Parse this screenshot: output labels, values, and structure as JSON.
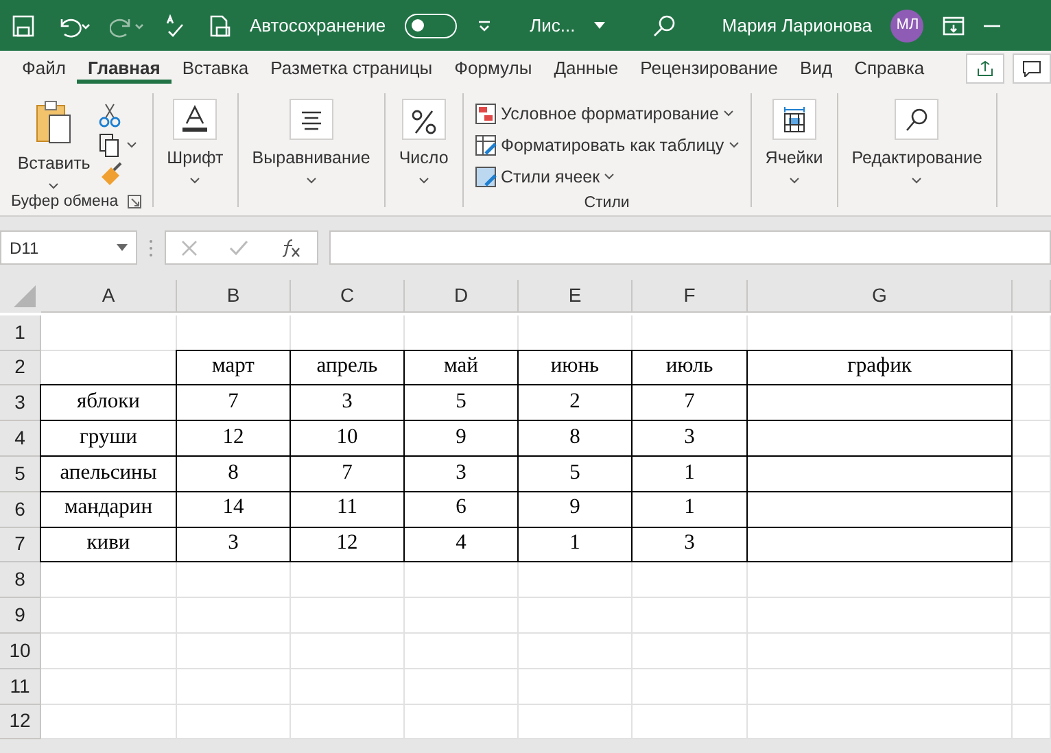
{
  "title_bar": {
    "autosave_label": "Автосохранение",
    "autosave_on": false,
    "file_name": "Лис...",
    "user_name": "Мария Ларионова",
    "avatar_initials": "МЛ"
  },
  "menu_tabs": [
    {
      "label": "Файл",
      "selected": false
    },
    {
      "label": "Главная",
      "selected": true
    },
    {
      "label": "Вставка",
      "selected": false
    },
    {
      "label": "Разметка страницы",
      "selected": false
    },
    {
      "label": "Формулы",
      "selected": false
    },
    {
      "label": "Данные",
      "selected": false
    },
    {
      "label": "Рецензирование",
      "selected": false
    },
    {
      "label": "Вид",
      "selected": false
    },
    {
      "label": "Справка",
      "selected": false
    }
  ],
  "ribbon_groups": [
    {
      "kind": "clipboard",
      "button": "Вставить",
      "label": "Буфер обмена"
    },
    {
      "kind": "font",
      "button": "Шрифт"
    },
    {
      "kind": "alignment",
      "button": "Выравнивание"
    },
    {
      "kind": "number",
      "button": "Число"
    },
    {
      "kind": "list",
      "items": [
        "Условное форматирование",
        "Форматировать как таблицу",
        "Стили ячеек"
      ],
      "label": "Стили"
    },
    {
      "kind": "cells",
      "button": "Ячейки"
    },
    {
      "kind": "editing",
      "button": "Редактирование"
    }
  ],
  "formula_bar": {
    "name_box": "D11"
  },
  "sheet": {
    "columns": [
      "A",
      "B",
      "C",
      "D",
      "E",
      "F",
      "G"
    ],
    "rows": [
      {
        "number": "1"
      },
      {
        "number": "2",
        "cells": [
          null,
          {
            "text": "март"
          },
          {
            "text": "апрель"
          },
          {
            "text": "май"
          },
          {
            "text": "июнь"
          },
          {
            "text": "июль"
          },
          {
            "text": "график"
          }
        ]
      },
      {
        "number": "3",
        "cells": [
          {
            "text": "яблоки"
          },
          {
            "text": "7"
          },
          {
            "text": "3"
          },
          {
            "text": "5"
          },
          {
            "text": "2"
          },
          {
            "text": "7"
          },
          {}
        ]
      },
      {
        "number": "4",
        "cells": [
          {
            "text": "груши"
          },
          {
            "text": "12"
          },
          {
            "text": "10"
          },
          {
            "text": "9"
          },
          {
            "text": "8"
          },
          {
            "text": "3"
          },
          {}
        ]
      },
      {
        "number": "5",
        "cells": [
          {
            "text": "апельсины"
          },
          {
            "text": "8"
          },
          {
            "text": "7"
          },
          {
            "text": "3"
          },
          {
            "text": "5"
          },
          {
            "text": "1"
          },
          {}
        ]
      },
      {
        "number": "6",
        "cells": [
          {
            "text": "мандарин"
          },
          {
            "text": "14"
          },
          {
            "text": "11"
          },
          {
            "text": "6"
          },
          {
            "text": "9"
          },
          {
            "text": "1"
          },
          {}
        ]
      },
      {
        "number": "7",
        "cells": [
          {
            "text": "киви"
          },
          {
            "text": "3"
          },
          {
            "text": "12"
          },
          {
            "text": "4"
          },
          {
            "text": "1"
          },
          {
            "text": "3"
          },
          {}
        ]
      },
      {
        "number": "8"
      },
      {
        "number": "9"
      },
      {
        "number": "10"
      },
      {
        "number": "11"
      },
      {
        "number": "12"
      }
    ]
  }
}
